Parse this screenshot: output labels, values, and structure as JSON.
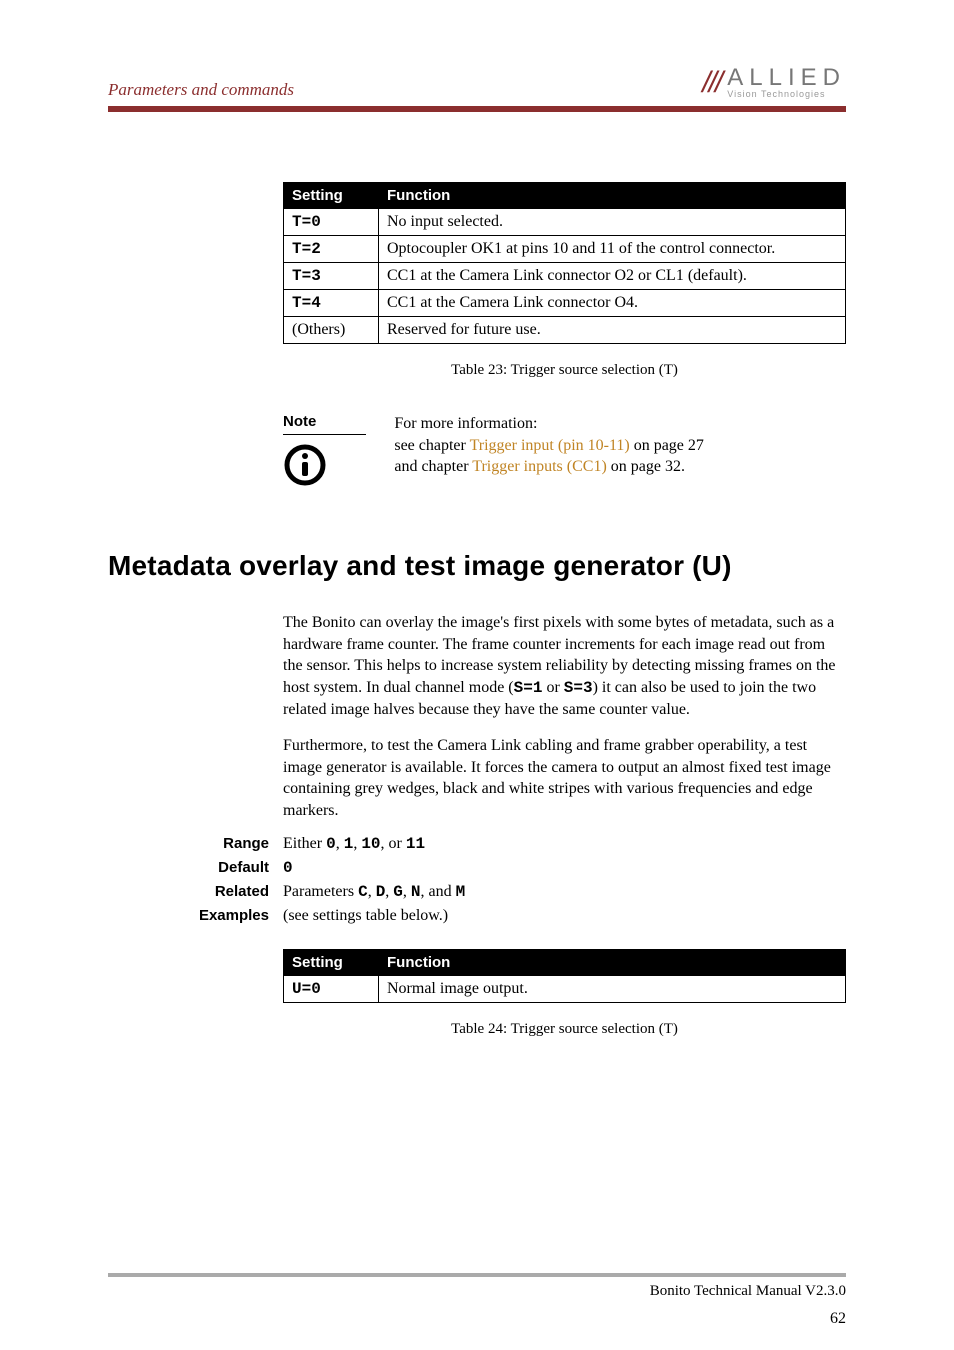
{
  "header": {
    "title": "Parameters and commands",
    "logo_main": "ALLIED",
    "logo_sub": "Vision Technologies"
  },
  "table23": {
    "head_setting": "Setting",
    "head_function": "Function",
    "rows": [
      {
        "setting": "T=0",
        "func": "No input selected."
      },
      {
        "setting": "T=2",
        "func": "Optocoupler OK1 at pins 10 and 11 of the control connector."
      },
      {
        "setting": "T=3",
        "func": "CC1 at the Camera Link connector O2 or CL1 (default)."
      },
      {
        "setting": "T=4",
        "func": "CC1 at the Camera Link connector O4."
      },
      {
        "setting": "(Others)",
        "func": "Reserved for future use."
      }
    ],
    "caption": "Table 23: Trigger source selection (T)"
  },
  "note": {
    "label": "Note",
    "line1": "For more information:",
    "line2a": "see chapter ",
    "line2link": "Trigger input (pin 10-11)",
    "line2b": " on page 27",
    "line3a": "and chapter ",
    "line3link": "Trigger inputs (CC1)",
    "line3b": " on page 32."
  },
  "section_title": "Metadata overlay and test image generator (U)",
  "para1a": "The Bonito can overlay the image's first pixels with some bytes of metadata, such as a hardware frame counter. The frame counter increments for each image read out from the sensor. This helps to increase system reliability by detecting missing frames on the host system. In dual channel mode (",
  "para1code1": "S=1",
  "para1mid": " or ",
  "para1code2": "S=3",
  "para1b": ") it can also be used to join the two related image halves because they have the same counter value.",
  "para2": "Furthermore, to test the Camera Link cabling and frame grabber operability, a test image generator is available. It forces the camera to output an almost fixed test image containing grey wedges, black and white stripes with various frequencies and edge markers.",
  "kv": {
    "range_label": "Range",
    "range_pre": "Either ",
    "range_c0": "0",
    "range_s0": ", ",
    "range_c1": "1",
    "range_s1": ", ",
    "range_c2": "10",
    "range_s2": ", or ",
    "range_c3": "11",
    "default_label": "Default",
    "default_value": "0",
    "related_label": "Related",
    "related_pre": "Parameters ",
    "related_c0": "C",
    "related_s0": ", ",
    "related_c1": "D",
    "related_s1": ", ",
    "related_c2": "G",
    "related_s2": ", ",
    "related_c3": "N",
    "related_s3": ", and ",
    "related_c4": "M",
    "examples_label": "Examples",
    "examples_value": "(see settings table below.)"
  },
  "table24": {
    "head_setting": "Setting",
    "head_function": "Function",
    "rows": [
      {
        "setting": "U=0",
        "func": "Normal image output."
      }
    ],
    "caption": "Table 24: Trigger source selection (T)"
  },
  "footer": {
    "manual": "Bonito Technical Manual V2.3.0",
    "page": "62"
  }
}
